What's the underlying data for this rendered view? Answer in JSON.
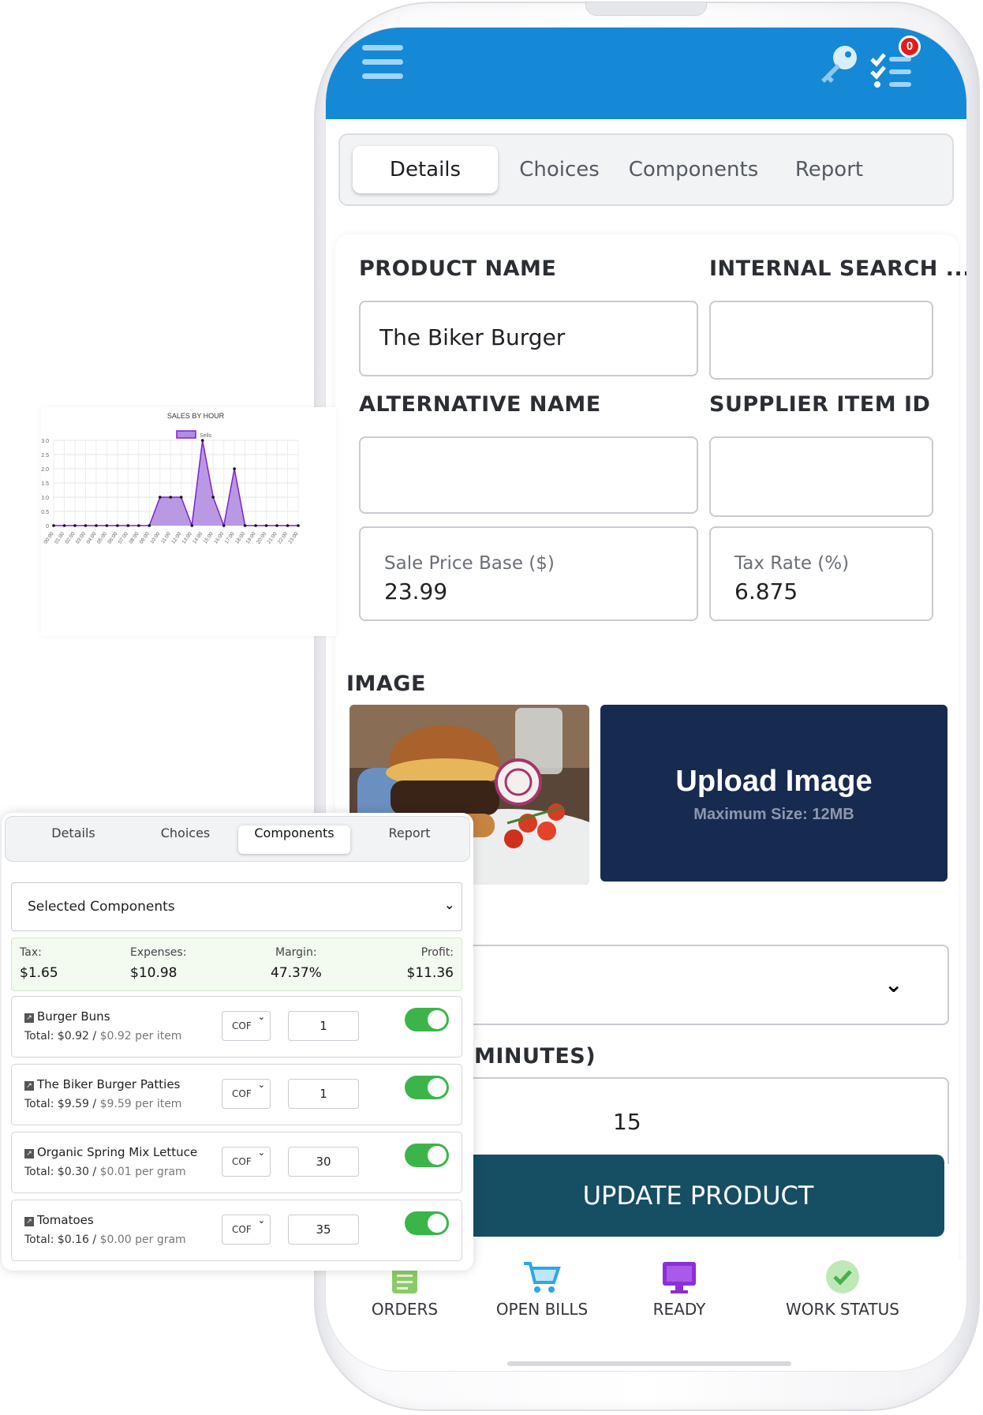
{
  "header": {
    "notification_count": "0"
  },
  "main_tabs": [
    "Details",
    "Choices",
    "Components",
    "Report"
  ],
  "form": {
    "product_name_label": "PRODUCT NAME",
    "product_name_value": "The Biker Burger",
    "internal_search_label": "INTERNAL SEARCH ...",
    "internal_search_value": "",
    "alt_name_label": "ALTERNATIVE NAME",
    "alt_name_value": "",
    "supplier_label": "SUPPLIER ITEM ID",
    "supplier_value": "",
    "sale_price_label": "Sale Price Base ($)",
    "sale_price_value": "23.99",
    "tax_rate_label": "Tax Rate (%)",
    "tax_rate_value": "6.875",
    "image_label": "IMAGE",
    "upload_title": "Upload Image",
    "upload_sub": "Maximum Size: 12MB",
    "minutes_label": "MINUTES)",
    "minutes_value": "15",
    "update_button": "UPDATE PRODUCT"
  },
  "bottom_nav": [
    {
      "label": "ORDERS",
      "icon": "clipboard-icon"
    },
    {
      "label": "OPEN BILLS",
      "icon": "cart-icon"
    },
    {
      "label": "READY",
      "icon": "monitor-icon"
    },
    {
      "label": "WORK STATUS",
      "icon": "check-circle-icon"
    }
  ],
  "components_panel": {
    "tabs": [
      "Details",
      "Choices",
      "Components",
      "Report"
    ],
    "select_label": "Selected Components",
    "summary": {
      "tax_label": "Tax:",
      "tax": "$1.65",
      "expenses_label": "Expenses:",
      "expenses": "$10.98",
      "margin_label": "Margin:",
      "margin": "47.37%",
      "profit_label": "Profit:",
      "profit": "$11.36"
    },
    "items": [
      {
        "name": "Burger Buns",
        "total": "Total: $0.92",
        "per": "$0.92 per item",
        "unit": "COF",
        "qty": "1",
        "enabled": true
      },
      {
        "name": "The Biker Burger Patties",
        "total": "Total: $9.59",
        "per": "$9.59 per item",
        "unit": "COF",
        "qty": "1",
        "enabled": true
      },
      {
        "name": "Organic Spring Mix Lettuce",
        "total": "Total: $0.30",
        "per": "$0.01 per gram",
        "unit": "COF",
        "qty": "30",
        "enabled": true
      },
      {
        "name": "Tomatoes",
        "total": "Total: $0.16",
        "per": "$0.00 per gram",
        "unit": "COF",
        "qty": "35",
        "enabled": true
      }
    ]
  },
  "chart_data": {
    "type": "area",
    "title": "SALES BY HOUR",
    "legend": [
      "Sells"
    ],
    "legend_position": "top",
    "x": [
      "00:00",
      "01:00",
      "02:00",
      "03:00",
      "04:00",
      "05:00",
      "06:00",
      "07:00",
      "08:00",
      "09:00",
      "10:00",
      "11:00",
      "12:00",
      "13:00",
      "14:00",
      "15:00",
      "16:00",
      "17:00",
      "18:00",
      "19:00",
      "20:00",
      "21:00",
      "22:00",
      "23:00"
    ],
    "series": [
      {
        "name": "Sells",
        "values": [
          0,
          0,
          0,
          0,
          0,
          0,
          0,
          0,
          0,
          0,
          1,
          1,
          1,
          0,
          3,
          1,
          0,
          2,
          0,
          0,
          0,
          0,
          0,
          0
        ]
      }
    ],
    "y_ticks": [
      "0",
      "0.5",
      "1.0",
      "1.5",
      "2.0",
      "2.5",
      "3.0"
    ],
    "ylim": [
      0,
      3
    ],
    "grid": true,
    "colors": {
      "line": "#7e22ce",
      "fill": "#b18ee0",
      "points": "#111111"
    }
  },
  "colors": {
    "header_blue": "#1588d6",
    "upload_navy": "#172a50",
    "update_btn": "#164e63",
    "toggle_green": "#3bb54a"
  }
}
